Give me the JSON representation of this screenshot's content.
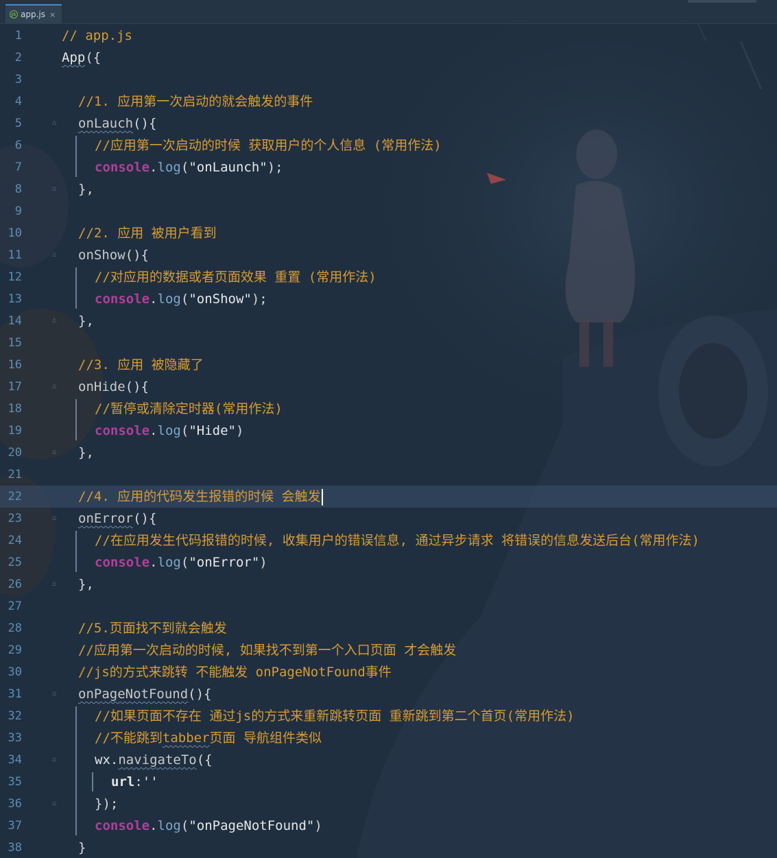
{
  "editor": {
    "tab": {
      "filename": "app.js",
      "icon": "nodejs-file-icon",
      "close": "×"
    },
    "current_line": 22,
    "lines": [
      {
        "n": "1",
        "indent": 0,
        "tokens": [
          [
            "c-comment",
            "// app.js"
          ]
        ]
      },
      {
        "n": "2",
        "indent": 0,
        "tokens": [
          [
            "c-ident squiggle",
            "App"
          ],
          [
            "c-punc",
            "({"
          ]
        ]
      },
      {
        "n": "3",
        "indent": 0,
        "tokens": []
      },
      {
        "n": "4",
        "indent": 1,
        "tokens": [
          [
            "c-comment",
            "//1. 应用第一次启动的就会触发的事件"
          ]
        ]
      },
      {
        "n": "5",
        "indent": 1,
        "tokens": [
          [
            "c-func squiggle",
            "onLauch"
          ],
          [
            "c-punc",
            "(){"
          ]
        ]
      },
      {
        "n": "6",
        "indent": 2,
        "tokens": [
          [
            "c-comment",
            "//应用第一次启动的时候 获取用户的个人信息 (常用作法)"
          ]
        ]
      },
      {
        "n": "7",
        "indent": 2,
        "tokens": [
          [
            "c-console",
            "console"
          ],
          [
            "c-punc",
            "."
          ],
          [
            "c-log",
            "log"
          ],
          [
            "c-punc",
            "("
          ],
          [
            "c-string",
            "\"onLaunch\""
          ],
          [
            "c-punc",
            ");"
          ]
        ]
      },
      {
        "n": "8",
        "indent": 1,
        "tokens": [
          [
            "c-punc",
            "},"
          ]
        ]
      },
      {
        "n": "9",
        "indent": 0,
        "tokens": []
      },
      {
        "n": "10",
        "indent": 1,
        "tokens": [
          [
            "c-comment",
            "//2. 应用 被用户看到"
          ]
        ]
      },
      {
        "n": "11",
        "indent": 1,
        "tokens": [
          [
            "c-func",
            "onShow"
          ],
          [
            "c-punc",
            "(){"
          ]
        ]
      },
      {
        "n": "12",
        "indent": 2,
        "tokens": [
          [
            "c-comment",
            "//对应用的数据或者页面效果 重置 (常用作法)"
          ]
        ]
      },
      {
        "n": "13",
        "indent": 2,
        "tokens": [
          [
            "c-console",
            "console"
          ],
          [
            "c-punc",
            "."
          ],
          [
            "c-log",
            "log"
          ],
          [
            "c-punc",
            "("
          ],
          [
            "c-string",
            "\"onShow\""
          ],
          [
            "c-punc",
            ");"
          ]
        ]
      },
      {
        "n": "14",
        "indent": 1,
        "tokens": [
          [
            "c-punc",
            "},"
          ]
        ]
      },
      {
        "n": "15",
        "indent": 0,
        "tokens": []
      },
      {
        "n": "16",
        "indent": 1,
        "tokens": [
          [
            "c-comment",
            "//3. 应用 被隐藏了"
          ]
        ]
      },
      {
        "n": "17",
        "indent": 1,
        "tokens": [
          [
            "c-func",
            "onHide"
          ],
          [
            "c-punc",
            "(){"
          ]
        ]
      },
      {
        "n": "18",
        "indent": 2,
        "tokens": [
          [
            "c-comment",
            "//暂停或清除定时器(常用作法)"
          ]
        ]
      },
      {
        "n": "19",
        "indent": 2,
        "tokens": [
          [
            "c-console",
            "console"
          ],
          [
            "c-punc",
            "."
          ],
          [
            "c-log",
            "log"
          ],
          [
            "c-punc",
            "("
          ],
          [
            "c-string",
            "\"Hide\""
          ],
          [
            "c-punc",
            ")"
          ]
        ]
      },
      {
        "n": "20",
        "indent": 1,
        "tokens": [
          [
            "c-punc",
            "},"
          ]
        ]
      },
      {
        "n": "21",
        "indent": 0,
        "tokens": []
      },
      {
        "n": "22",
        "indent": 1,
        "tokens": [
          [
            "c-comment",
            "//4. 应用的代码发生报错的时候 会触发"
          ]
        ]
      },
      {
        "n": "23",
        "indent": 1,
        "tokens": [
          [
            "c-func squiggle",
            "onError"
          ],
          [
            "c-punc",
            "(){"
          ]
        ]
      },
      {
        "n": "24",
        "indent": 2,
        "tokens": [
          [
            "c-comment",
            "//在应用发生代码报错的时候, 收集用户的错误信息, 通过异步请求 将错误的信息发送后台(常用作法)"
          ]
        ]
      },
      {
        "n": "25",
        "indent": 2,
        "tokens": [
          [
            "c-console",
            "console"
          ],
          [
            "c-punc",
            "."
          ],
          [
            "c-log",
            "log"
          ],
          [
            "c-punc",
            "("
          ],
          [
            "c-string",
            "\"onError\""
          ],
          [
            "c-punc",
            ")"
          ]
        ]
      },
      {
        "n": "26",
        "indent": 1,
        "tokens": [
          [
            "c-punc",
            "},"
          ]
        ]
      },
      {
        "n": "27",
        "indent": 0,
        "tokens": []
      },
      {
        "n": "28",
        "indent": 1,
        "tokens": [
          [
            "c-comment",
            "//5.页面找不到就会触发"
          ]
        ]
      },
      {
        "n": "29",
        "indent": 1,
        "tokens": [
          [
            "c-comment",
            "//应用第一次启动的时候, 如果找不到第一个入口页面 才会触发"
          ]
        ]
      },
      {
        "n": "30",
        "indent": 1,
        "tokens": [
          [
            "c-comment",
            "//js的方式来跳转 不能触发 onPageNotFound事件"
          ]
        ]
      },
      {
        "n": "31",
        "indent": 1,
        "tokens": [
          [
            "c-func squiggle",
            "onPageNotFound"
          ],
          [
            "c-punc",
            "(){"
          ]
        ]
      },
      {
        "n": "32",
        "indent": 2,
        "tokens": [
          [
            "c-comment",
            "//如果页面不存在 通过js的方式来重新跳转页面 重新跳到第二个首页(常用作法)"
          ]
        ]
      },
      {
        "n": "33",
        "indent": 2,
        "tokens": [
          [
            "c-comment",
            "//不能跳到"
          ],
          [
            "c-comment squiggle",
            "tabber"
          ],
          [
            "c-comment",
            "页面 导航组件类似"
          ]
        ]
      },
      {
        "n": "34",
        "indent": 2,
        "tokens": [
          [
            "c-ident",
            "wx"
          ],
          [
            "c-punc",
            "."
          ],
          [
            "c-func squiggle",
            "navigateTo"
          ],
          [
            "c-punc",
            "({"
          ]
        ]
      },
      {
        "n": "35",
        "indent": 3,
        "tokens": [
          [
            "c-key",
            "url"
          ],
          [
            "c-punc",
            ":"
          ],
          [
            "c-string",
            "''"
          ]
        ]
      },
      {
        "n": "36",
        "indent": 2,
        "tokens": [
          [
            "c-punc",
            "});"
          ]
        ]
      },
      {
        "n": "37",
        "indent": 2,
        "tokens": [
          [
            "c-console",
            "console"
          ],
          [
            "c-punc",
            "."
          ],
          [
            "c-log",
            "log"
          ],
          [
            "c-punc",
            "("
          ],
          [
            "c-string",
            "\"onPageNotFound\""
          ],
          [
            "c-punc",
            ")"
          ]
        ]
      },
      {
        "n": "38",
        "indent": 1,
        "tokens": [
          [
            "c-punc",
            "}"
          ]
        ]
      }
    ]
  }
}
